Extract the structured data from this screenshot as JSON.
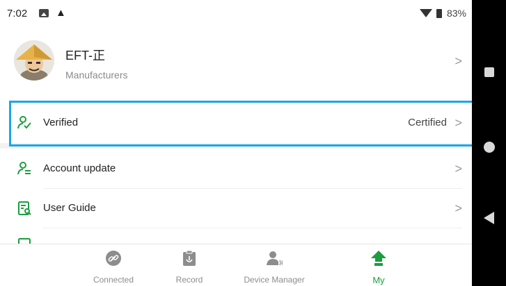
{
  "status_bar": {
    "time": "7:02",
    "warning_glyph": "▲",
    "battery": "83%"
  },
  "profile": {
    "name": "EFT-正",
    "role": "Manufacturers"
  },
  "menu": {
    "verified": {
      "label": "Verified",
      "value": "Certified"
    },
    "account_update": {
      "label": "Account update"
    },
    "user_guide": {
      "label": "User Guide"
    }
  },
  "chevron": ">",
  "tabs": [
    {
      "label": "Connected",
      "icon": "link-icon"
    },
    {
      "label": "Record",
      "icon": "clipboard-icon"
    },
    {
      "label": "Device Manager",
      "icon": "device-user-icon"
    },
    {
      "label": "My",
      "icon": "home-up-icon",
      "active": true
    }
  ],
  "colors": {
    "accent_green": "#1a9e3e",
    "highlight_blue": "#1aa7e8"
  }
}
